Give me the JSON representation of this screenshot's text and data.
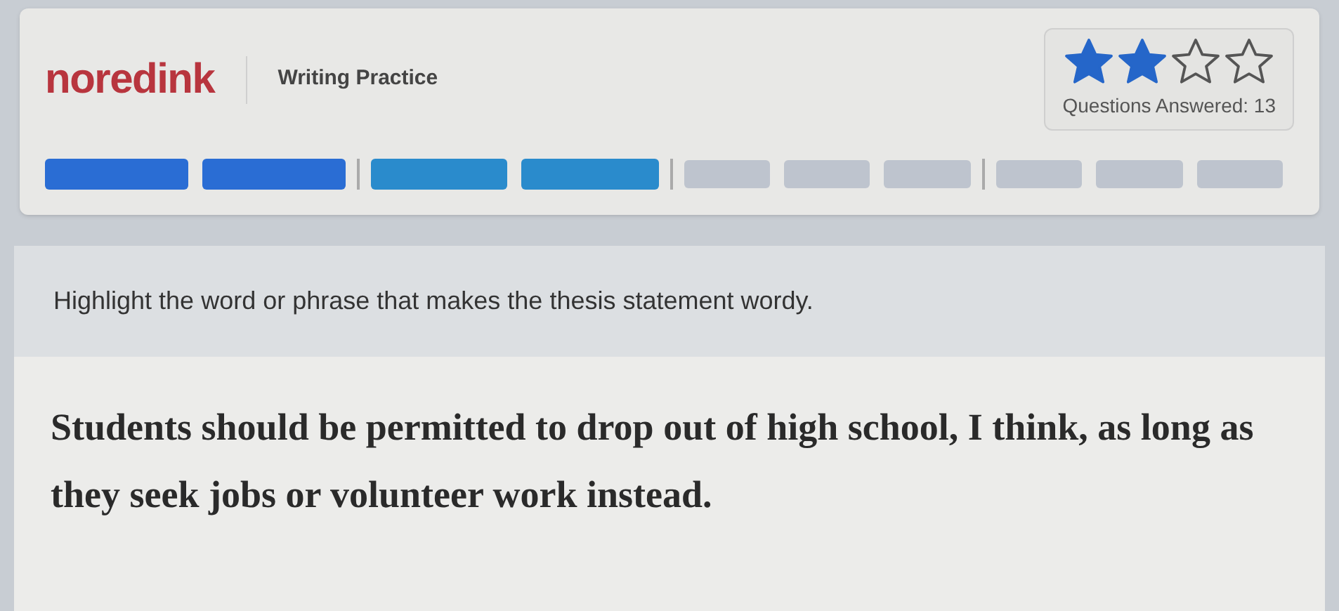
{
  "header": {
    "logo": "noredink",
    "title": "Writing Practice",
    "stars": 2,
    "questions_answered": "Questions Answered: 13"
  },
  "progress": {
    "groups": [
      [
        {
          "done": true,
          "color": "#2a6dd4"
        },
        {
          "done": true,
          "color": "#2a6dd4"
        }
      ],
      [
        {
          "done": true,
          "color": "#2a8bcc"
        },
        {
          "done": true,
          "color": "#2a8bcc"
        }
      ],
      [
        {
          "done": false,
          "color": "#b9c0cb"
        },
        {
          "done": false,
          "color": "#b9c0cb"
        },
        {
          "done": false,
          "color": "#b9c0cb"
        }
      ],
      [
        {
          "done": false,
          "color": "#b9c0cb"
        },
        {
          "done": false,
          "color": "#b9c0cb"
        },
        {
          "done": false,
          "color": "#b9c0cb"
        }
      ]
    ]
  },
  "question": {
    "prompt": "Highlight the word or phrase that makes the thesis statement wordy.",
    "passage": "Students should be permitted to drop out of high school, I think, as long as they seek jobs or volunteer work instead."
  }
}
